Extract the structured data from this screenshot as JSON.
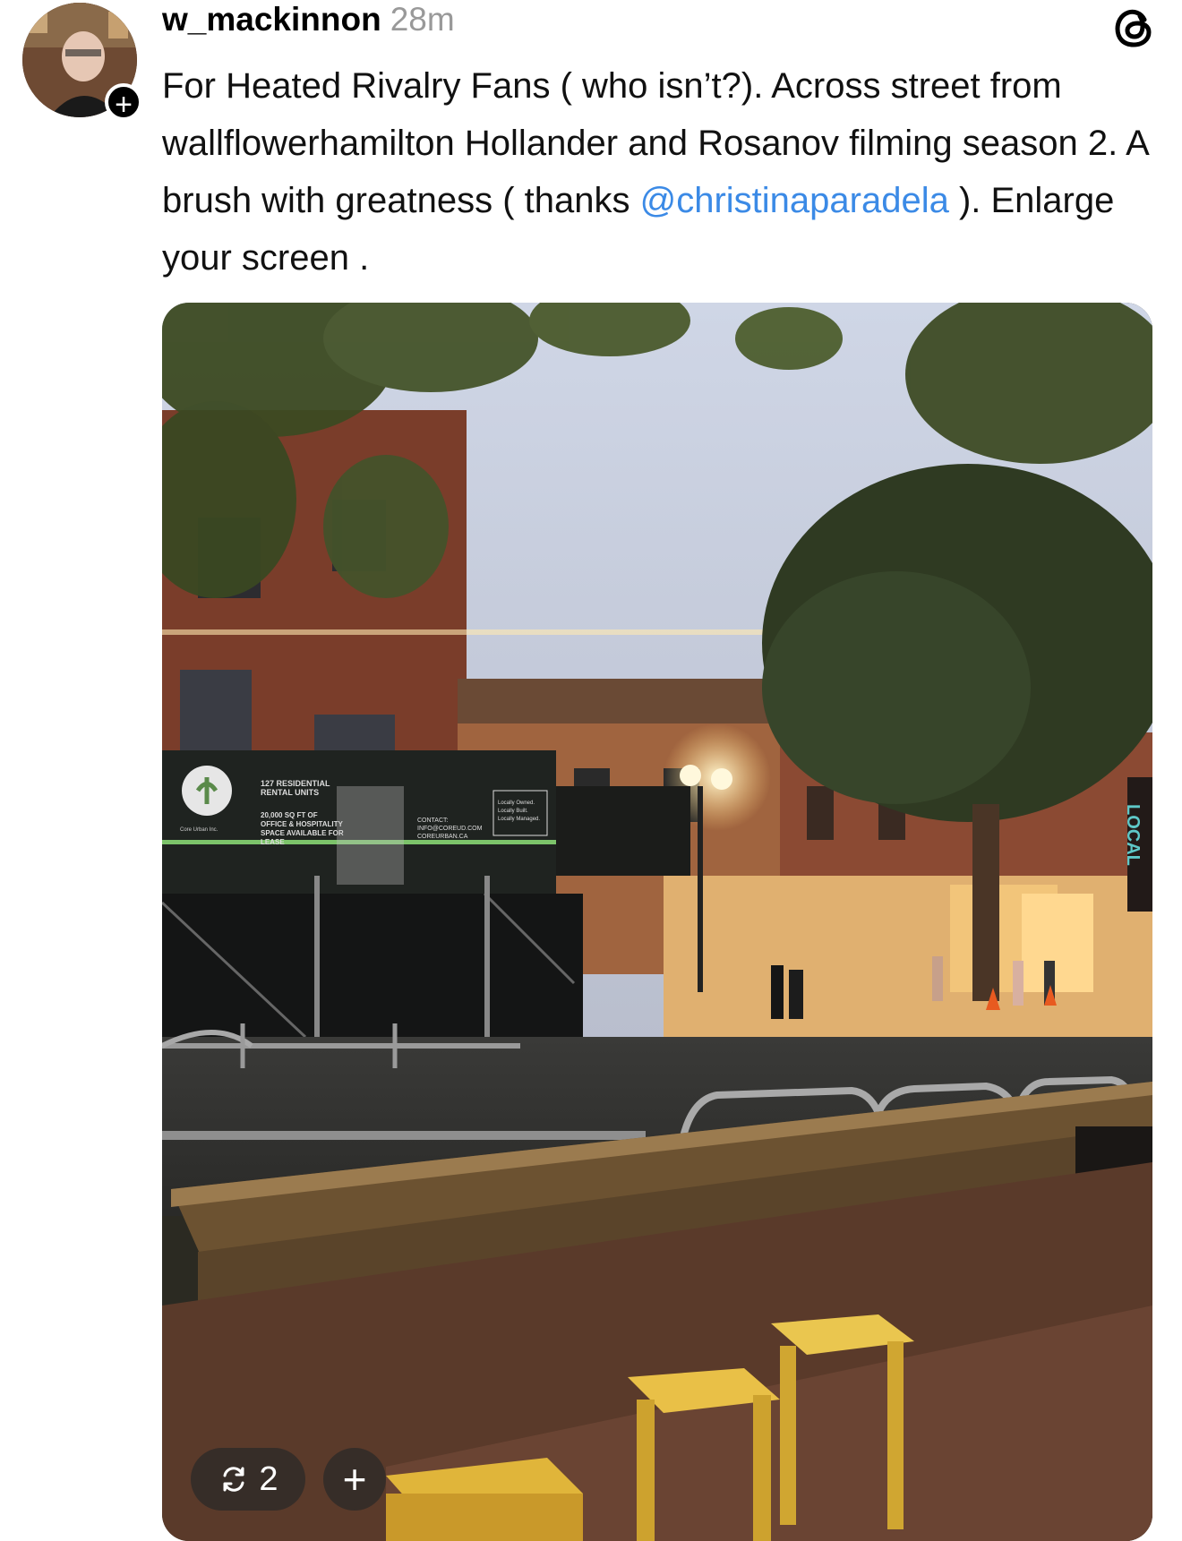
{
  "post": {
    "username": "w_mackinnon",
    "timestamp": "28m",
    "text_before_mention": "For Heated Rivalry Fans ( who isn’t?). Across street from wallflowerhamilton Hollander and Rosanov filming season 2. A brush with greatness ( thanks ",
    "mention": "@christinaparadela",
    "text_after_mention": " ). Enlarge your screen ."
  },
  "follow_badge": "+",
  "media": {
    "billboard": {
      "line1": "127 RESIDENTIAL",
      "line2": "RENTAL UNITS",
      "line3": "20,000 SQ FT OF",
      "line4": "OFFICE & HOSPITALITY",
      "line5": "SPACE AVAILABLE FOR",
      "line6": "LEASE",
      "contact1": "CONTACT:",
      "contact2": "INFO@COREUD.COM",
      "contact3": "COREURBAN.CA",
      "brand": "Core Urban Inc.",
      "slogan1": "Locally Owned.",
      "slogan2": "Locally Built.",
      "slogan3": "Locally Managed."
    },
    "sign_text": "LOCAL"
  },
  "overlay": {
    "repost_count": "2",
    "add_symbol": "+"
  },
  "icons": {
    "threads": "threads-logo-icon",
    "repost": "repost-icon",
    "add": "plus-icon"
  }
}
